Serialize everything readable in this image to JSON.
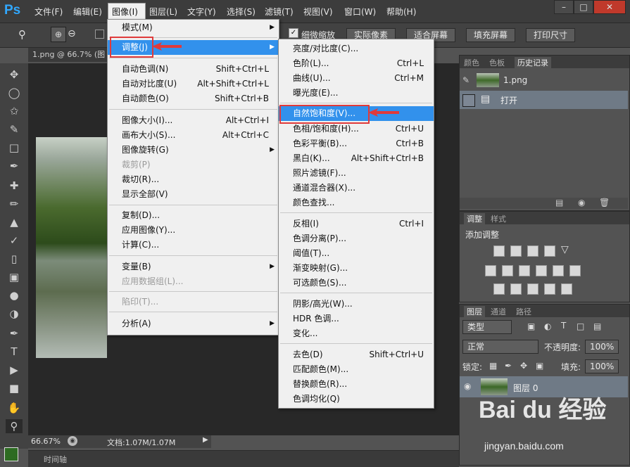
{
  "app": {
    "logo": "Ps"
  },
  "menubar": {
    "items": [
      "文件(F)",
      "编辑(E)",
      "图像(I)",
      "图层(L)",
      "文字(Y)",
      "选择(S)",
      "滤镜(T)",
      "视图(V)",
      "窗口(W)",
      "帮助(H)"
    ]
  },
  "window_controls": {
    "minimize": "–",
    "maximize": "□",
    "close": "✕"
  },
  "options": {
    "fine_zoom_label": "细微缩放",
    "actual_pixels": "实际像素",
    "fit_screen": "适合屏幕",
    "fill_screen": "填充屏幕",
    "print_size": "打印尺寸"
  },
  "document": {
    "tab_title": "1.png @ 66.7% (图",
    "zoom": "66.67%",
    "doc_info": "文档:1.07M/1.07M"
  },
  "timeline": {
    "label": "时间轴"
  },
  "image_menu": {
    "items": [
      {
        "label": "模式(M)",
        "submenu": true
      },
      {
        "label": "调整(J)",
        "submenu": true,
        "highlight": true
      },
      {
        "label": "自动色调(N)",
        "shortcut": "Shift+Ctrl+L"
      },
      {
        "label": "自动对比度(U)",
        "shortcut": "Alt+Shift+Ctrl+L"
      },
      {
        "label": "自动颜色(O)",
        "shortcut": "Shift+Ctrl+B"
      },
      {
        "label": "图像大小(I)...",
        "shortcut": "Alt+Ctrl+I"
      },
      {
        "label": "画布大小(S)...",
        "shortcut": "Alt+Ctrl+C"
      },
      {
        "label": "图像旋转(G)",
        "submenu": true
      },
      {
        "label": "裁剪(P)",
        "disabled": true
      },
      {
        "label": "裁切(R)..."
      },
      {
        "label": "显示全部(V)"
      },
      {
        "label": "复制(D)..."
      },
      {
        "label": "应用图像(Y)..."
      },
      {
        "label": "计算(C)..."
      },
      {
        "label": "变量(B)",
        "submenu": true
      },
      {
        "label": "应用数据组(L)...",
        "disabled": true
      },
      {
        "label": "陷印(T)...",
        "disabled": true
      },
      {
        "label": "分析(A)",
        "submenu": true
      }
    ]
  },
  "adjust_menu": {
    "items": [
      {
        "label": "亮度/对比度(C)..."
      },
      {
        "label": "色阶(L)...",
        "shortcut": "Ctrl+L"
      },
      {
        "label": "曲线(U)...",
        "shortcut": "Ctrl+M"
      },
      {
        "label": "曝光度(E)..."
      },
      {
        "label": "自然饱和度(V)...",
        "highlight": true
      },
      {
        "label": "色相/饱和度(H)...",
        "shortcut": "Ctrl+U"
      },
      {
        "label": "色彩平衡(B)...",
        "shortcut": "Ctrl+B"
      },
      {
        "label": "黑白(K)...",
        "shortcut": "Alt+Shift+Ctrl+B"
      },
      {
        "label": "照片滤镜(F)..."
      },
      {
        "label": "通道混合器(X)..."
      },
      {
        "label": "颜色查找..."
      },
      {
        "label": "反相(I)",
        "shortcut": "Ctrl+I"
      },
      {
        "label": "色调分离(P)..."
      },
      {
        "label": "阈值(T)..."
      },
      {
        "label": "渐变映射(G)..."
      },
      {
        "label": "可选颜色(S)..."
      },
      {
        "label": "阴影/高光(W)..."
      },
      {
        "label": "HDR 色调..."
      },
      {
        "label": "变化..."
      },
      {
        "label": "去色(D)",
        "shortcut": "Shift+Ctrl+U"
      },
      {
        "label": "匹配颜色(M)..."
      },
      {
        "label": "替换颜色(R)..."
      },
      {
        "label": "色调均化(Q)"
      }
    ]
  },
  "history_panel": {
    "tabs": [
      "颜色",
      "色板",
      "历史记录"
    ],
    "snapshot": "1.png",
    "step": "打开"
  },
  "adjustments_panel": {
    "tabs": [
      "调整",
      "样式"
    ],
    "title": "添加调整"
  },
  "layers_panel": {
    "tabs": [
      "图层",
      "通道",
      "路径"
    ],
    "filter": "类型",
    "blend": "正常",
    "opacity_label": "不透明度:",
    "opacity": "100%",
    "lock_label": "锁定:",
    "fill_label": "填充:",
    "fill": "100%",
    "layer_name": "图层 0"
  },
  "watermark": {
    "brand": "Bai du 经验",
    "url": "jingyan.baidu.com"
  },
  "colors": {
    "highlight": "#3291ec",
    "annotation": "#e03a3a",
    "ps_blue": "#31a8ff"
  }
}
